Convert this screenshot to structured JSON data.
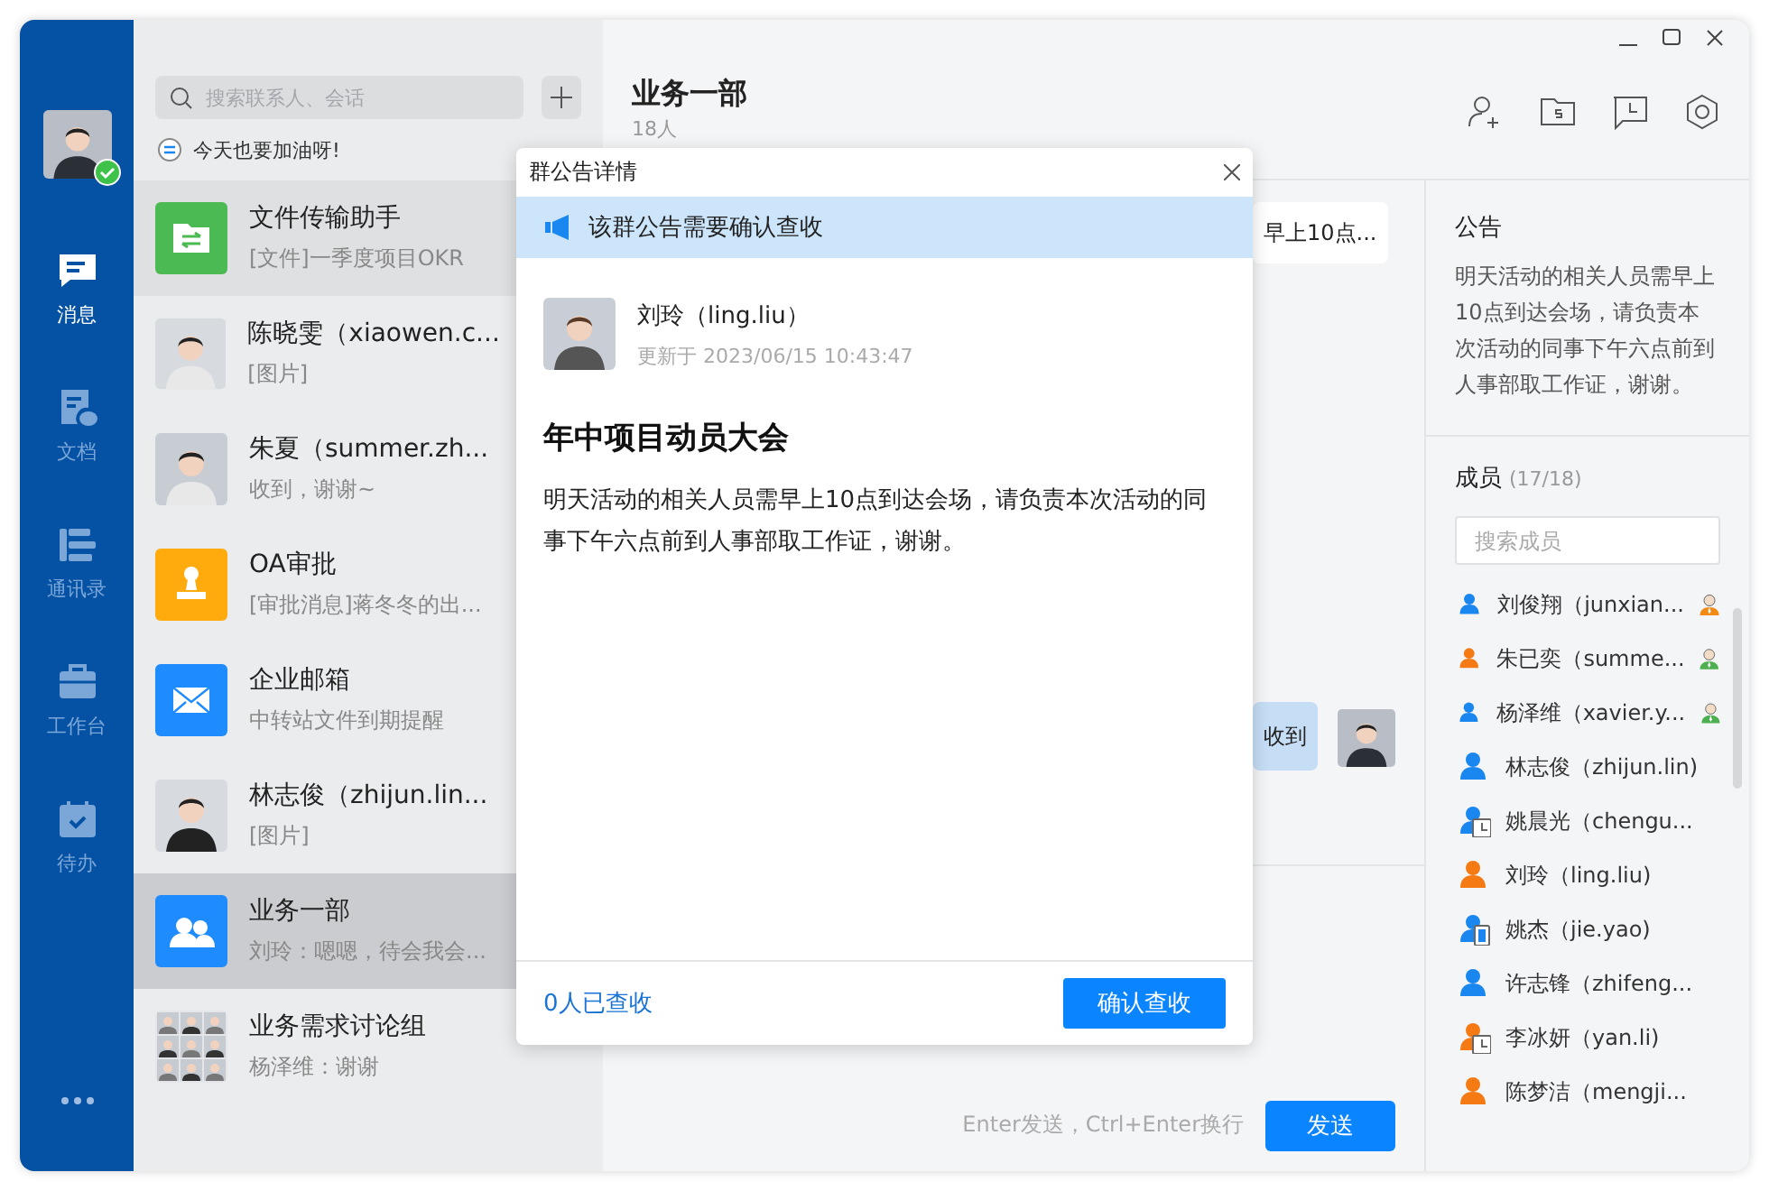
{
  "nav": {
    "items": [
      {
        "label": "消息",
        "kind": "chat",
        "selected": true
      },
      {
        "label": "文档",
        "kind": "docs",
        "selected": false
      },
      {
        "label": "通讯录",
        "kind": "contacts",
        "selected": false
      },
      {
        "label": "工作台",
        "kind": "workbench",
        "selected": false
      },
      {
        "label": "待办",
        "kind": "todo",
        "selected": false
      }
    ],
    "online": true
  },
  "conversations": {
    "search": {
      "placeholder": "搜索联系人、会话"
    },
    "status_text": "今天也要加油呀!",
    "items": [
      {
        "name": "文件传输助手",
        "preview": "[文件]一季度项目OKR",
        "kind": "file-transfer",
        "hovered": true,
        "selected": false
      },
      {
        "name": "陈晓雯（xiaowen.c...",
        "preview": "[图片]",
        "kind": "person",
        "hovered": false,
        "selected": false
      },
      {
        "name": "朱夏（summer.zh...",
        "preview": "收到，谢谢~",
        "kind": "person",
        "hovered": false,
        "selected": false
      },
      {
        "name": "OA审批",
        "preview": "[审批消息]蒋冬冬的出...",
        "kind": "approval",
        "hovered": false,
        "selected": false
      },
      {
        "name": "企业邮箱",
        "preview": "中转站文件到期提醒",
        "kind": "mail",
        "hovered": false,
        "selected": false
      },
      {
        "name": "林志俊（zhijun.lin...",
        "preview": "[图片]",
        "kind": "person",
        "hovered": false,
        "selected": false
      },
      {
        "name": "业务一部",
        "preview": "刘玲：嗯嗯，待会我会...",
        "kind": "group",
        "hovered": false,
        "selected": true
      },
      {
        "name": "业务需求讨论组",
        "preview": "杨泽维：谢谢",
        "kind": "group-grid",
        "hovered": false,
        "selected": false
      }
    ]
  },
  "chat": {
    "title": "业务一部",
    "subtitle": "18人",
    "messages": [
      {
        "text": "早上10点...",
        "own": false
      },
      {
        "text": "收到",
        "own": true
      }
    ],
    "input_hint": "Enter发送，Ctrl+Enter换行",
    "send_button": "发送"
  },
  "side_panel": {
    "notice_title": "公告",
    "notice_text": "明天活动的相关人员需早上10点到达会场，请负责本次活动的同事下午六点前到人事部取工作证，谢谢。",
    "members_title": "成员",
    "members_count": "(17/18)",
    "member_search": {
      "placeholder": "搜索成员"
    },
    "members": [
      {
        "name": "刘俊翔（junxian...",
        "color": "#1a86f0",
        "kind": "user",
        "owner": true,
        "admin": false
      },
      {
        "name": "朱已奕（summe...",
        "color": "#f57a14",
        "kind": "user",
        "owner": false,
        "admin": true
      },
      {
        "name": "杨泽维（xavier.y...",
        "color": "#1a86f0",
        "kind": "user",
        "owner": false,
        "admin": true
      },
      {
        "name": "林志俊（zhijun.lin)",
        "color": "#1a86f0",
        "kind": "user",
        "owner": false,
        "admin": false
      },
      {
        "name": "姚晨光（chengu...",
        "color": "#1a86f0",
        "kind": "away",
        "owner": false,
        "admin": false
      },
      {
        "name": "刘玲（ling.liu)",
        "color": "#f57a14",
        "kind": "user",
        "owner": false,
        "admin": false
      },
      {
        "name": "姚杰（jie.yao)",
        "color": "#1a86f0",
        "kind": "mobile",
        "owner": false,
        "admin": false
      },
      {
        "name": "许志锋（zhifeng...",
        "color": "#1a86f0",
        "kind": "user",
        "owner": false,
        "admin": false
      },
      {
        "name": "李冰妍（yan.li)",
        "color": "#f57a14",
        "kind": "away",
        "owner": false,
        "admin": false
      },
      {
        "name": "陈梦洁（mengji...",
        "color": "#f57a14",
        "kind": "user",
        "owner": false,
        "admin": false
      }
    ]
  },
  "dialog": {
    "title": "群公告详情",
    "notice_bar": "该群公告需要确认查收",
    "author": "刘玲（ling.liu）",
    "updated": "更新于 2023/06/15 10:43:47",
    "heading": "年中项目动员大会",
    "body": "明天活动的相关人员需早上10点到达会场，请负责本次活动的同事下午六点前到人事部取工作证，谢谢。",
    "read_count": "0人已查收",
    "confirm_button": "确认查收"
  }
}
